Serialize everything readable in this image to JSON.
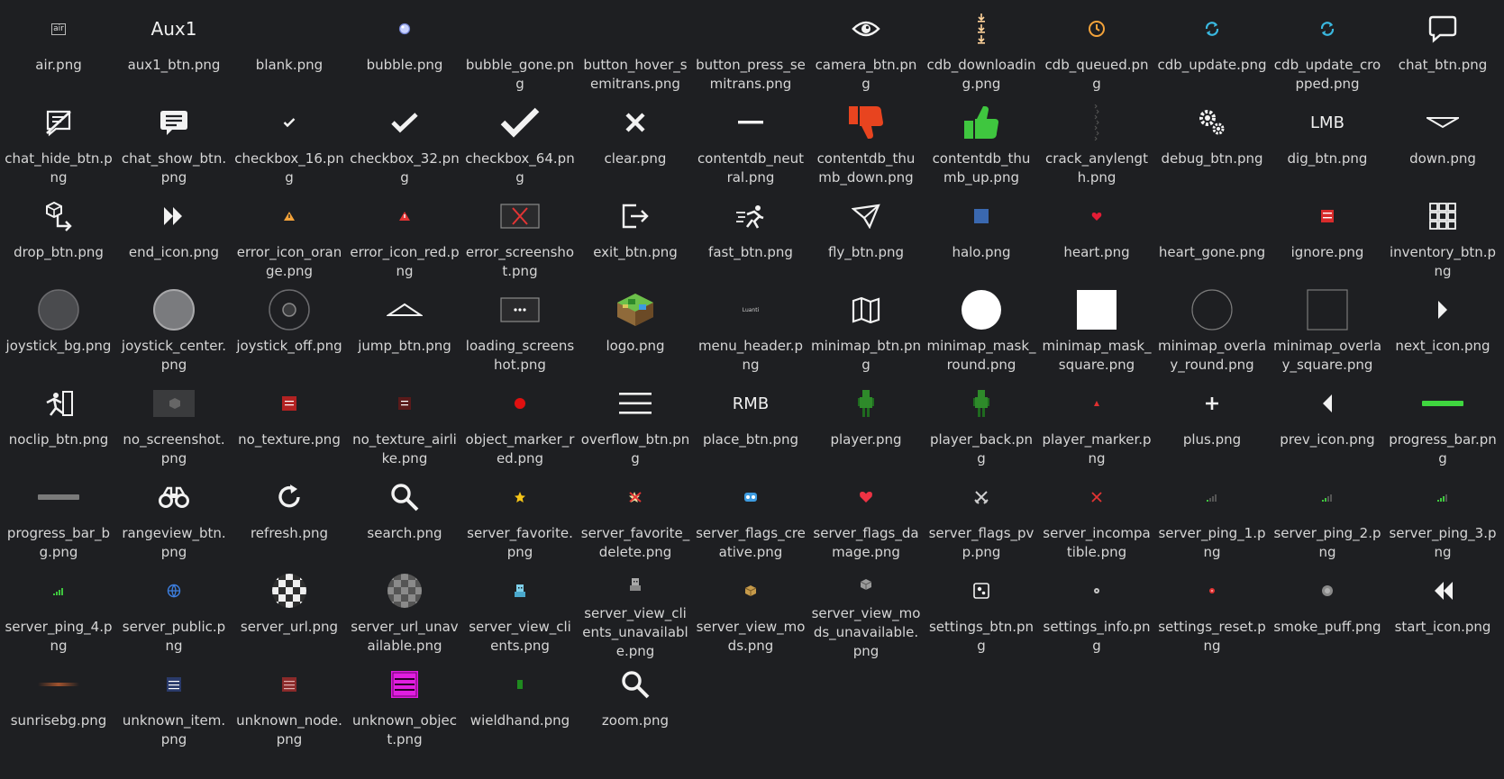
{
  "icon_text": {
    "aux1": "Aux1",
    "lmb": "LMB",
    "rmb": "RMB",
    "air": "air"
  },
  "colors": {
    "background": "#1e1f22",
    "text": "#d6d6d6",
    "thumb_down": "#e8441f",
    "thumb_up": "#3fc63f",
    "heart": "#e31c35",
    "progress_bar": "#3fd63f",
    "cyan_sync": "#3ab8e0",
    "orange_clock": "#f3a23a"
  },
  "files": [
    {
      "name": "air.png",
      "icon": "air"
    },
    {
      "name": "aux1_btn.png",
      "icon": "aux1"
    },
    {
      "name": "blank.png",
      "icon": "blank"
    },
    {
      "name": "bubble.png",
      "icon": "bubble"
    },
    {
      "name": "bubble_gone.png",
      "icon": "blank"
    },
    {
      "name": "button_hover_semitrans.png",
      "icon": "blank"
    },
    {
      "name": "button_press_semitrans.png",
      "icon": "blank"
    },
    {
      "name": "camera_btn.png",
      "icon": "eye"
    },
    {
      "name": "cdb_downloading.png",
      "icon": "download"
    },
    {
      "name": "cdb_queued.png",
      "icon": "clock"
    },
    {
      "name": "cdb_update.png",
      "icon": "sync"
    },
    {
      "name": "cdb_update_cropped.png",
      "icon": "sync"
    },
    {
      "name": "chat_btn.png",
      "icon": "chat"
    },
    {
      "name": "chat_hide_btn.png",
      "icon": "chat-hide"
    },
    {
      "name": "chat_show_btn.png",
      "icon": "chat-show"
    },
    {
      "name": "checkbox_16.png",
      "icon": "check-s"
    },
    {
      "name": "checkbox_32.png",
      "icon": "check-m"
    },
    {
      "name": "checkbox_64.png",
      "icon": "check-l"
    },
    {
      "name": "clear.png",
      "icon": "x"
    },
    {
      "name": "contentdb_neutral.png",
      "icon": "minus"
    },
    {
      "name": "contentdb_thumb_down.png",
      "icon": "thumb-down"
    },
    {
      "name": "contentdb_thumb_up.png",
      "icon": "thumb-up"
    },
    {
      "name": "crack_anylength.png",
      "icon": "crack"
    },
    {
      "name": "debug_btn.png",
      "icon": "gears"
    },
    {
      "name": "dig_btn.png",
      "icon": "lmb"
    },
    {
      "name": "down.png",
      "icon": "down"
    },
    {
      "name": "drop_btn.png",
      "icon": "drop"
    },
    {
      "name": "end_icon.png",
      "icon": "end"
    },
    {
      "name": "error_icon_orange.png",
      "icon": "warn-orange"
    },
    {
      "name": "error_icon_red.png",
      "icon": "warn-red"
    },
    {
      "name": "error_screenshot.png",
      "icon": "error-screen"
    },
    {
      "name": "exit_btn.png",
      "icon": "exit"
    },
    {
      "name": "fast_btn.png",
      "icon": "fast"
    },
    {
      "name": "fly_btn.png",
      "icon": "fly"
    },
    {
      "name": "halo.png",
      "icon": "halo"
    },
    {
      "name": "heart.png",
      "icon": "heart-s"
    },
    {
      "name": "heart_gone.png",
      "icon": "blank"
    },
    {
      "name": "ignore.png",
      "icon": "ignore"
    },
    {
      "name": "inventory_btn.png",
      "icon": "inventory"
    },
    {
      "name": "joystick_bg.png",
      "icon": "joy-bg"
    },
    {
      "name": "joystick_center.png",
      "icon": "joy-center"
    },
    {
      "name": "joystick_off.png",
      "icon": "joy-off"
    },
    {
      "name": "jump_btn.png",
      "icon": "jump"
    },
    {
      "name": "loading_screenshot.png",
      "icon": "loading-screen"
    },
    {
      "name": "logo.png",
      "icon": "logo"
    },
    {
      "name": "menu_header.png",
      "icon": "menu-header"
    },
    {
      "name": "minimap_btn.png",
      "icon": "map"
    },
    {
      "name": "minimap_mask_round.png",
      "icon": "mask-round"
    },
    {
      "name": "minimap_mask_square.png",
      "icon": "mask-square"
    },
    {
      "name": "minimap_overlay_round.png",
      "icon": "overlay-round"
    },
    {
      "name": "minimap_overlay_square.png",
      "icon": "overlay-square"
    },
    {
      "name": "next_icon.png",
      "icon": "next"
    },
    {
      "name": "noclip_btn.png",
      "icon": "noclip"
    },
    {
      "name": "no_screenshot.png",
      "icon": "no-screenshot"
    },
    {
      "name": "no_texture.png",
      "icon": "no-texture"
    },
    {
      "name": "no_texture_airlike.png",
      "icon": "no-texture-air"
    },
    {
      "name": "object_marker_red.png",
      "icon": "marker-red"
    },
    {
      "name": "overflow_btn.png",
      "icon": "hamburger"
    },
    {
      "name": "place_btn.png",
      "icon": "rmb"
    },
    {
      "name": "player.png",
      "icon": "player"
    },
    {
      "name": "player_back.png",
      "icon": "player"
    },
    {
      "name": "player_marker.png",
      "icon": "player-marker"
    },
    {
      "name": "plus.png",
      "icon": "plus"
    },
    {
      "name": "prev_icon.png",
      "icon": "prev"
    },
    {
      "name": "progress_bar.png",
      "icon": "bar-green"
    },
    {
      "name": "progress_bar_bg.png",
      "icon": "bar-gray"
    },
    {
      "name": "rangeview_btn.png",
      "icon": "binoculars"
    },
    {
      "name": "refresh.png",
      "icon": "refresh"
    },
    {
      "name": "search.png",
      "icon": "search"
    },
    {
      "name": "server_favorite.png",
      "icon": "star"
    },
    {
      "name": "server_favorite_delete.png",
      "icon": "star-delete"
    },
    {
      "name": "server_flags_creative.png",
      "icon": "creative"
    },
    {
      "name": "server_flags_damage.png",
      "icon": "heart-damage"
    },
    {
      "name": "server_flags_pvp.png",
      "icon": "pvp"
    },
    {
      "name": "server_incompatible.png",
      "icon": "x-red"
    },
    {
      "name": "server_ping_1.png",
      "icon": "ping1"
    },
    {
      "name": "server_ping_2.png",
      "icon": "ping2"
    },
    {
      "name": "server_ping_3.png",
      "icon": "ping3"
    },
    {
      "name": "server_ping_4.png",
      "icon": "ping4"
    },
    {
      "name": "server_public.png",
      "icon": "globe"
    },
    {
      "name": "server_url.png",
      "icon": "url"
    },
    {
      "name": "server_url_unavailable.png",
      "icon": "url-off"
    },
    {
      "name": "server_view_clients.png",
      "icon": "client"
    },
    {
      "name": "server_view_clients_unavailable.png",
      "icon": "client-off"
    },
    {
      "name": "server_view_mods.png",
      "icon": "mods"
    },
    {
      "name": "server_view_mods_unavailable.png",
      "icon": "mods-off"
    },
    {
      "name": "settings_btn.png",
      "icon": "settings"
    },
    {
      "name": "settings_info.png",
      "icon": "info-dot"
    },
    {
      "name": "settings_reset.png",
      "icon": "reset-dot"
    },
    {
      "name": "smoke_puff.png",
      "icon": "smoke"
    },
    {
      "name": "start_icon.png",
      "icon": "start"
    },
    {
      "name": "sunrisebg.png",
      "icon": "sunrise"
    },
    {
      "name": "unknown_item.png",
      "icon": "unknown-item"
    },
    {
      "name": "unknown_node.png",
      "icon": "unknown-node"
    },
    {
      "name": "unknown_object.png",
      "icon": "unknown-object"
    },
    {
      "name": "wieldhand.png",
      "icon": "wieldhand"
    },
    {
      "name": "zoom.png",
      "icon": "search"
    }
  ]
}
